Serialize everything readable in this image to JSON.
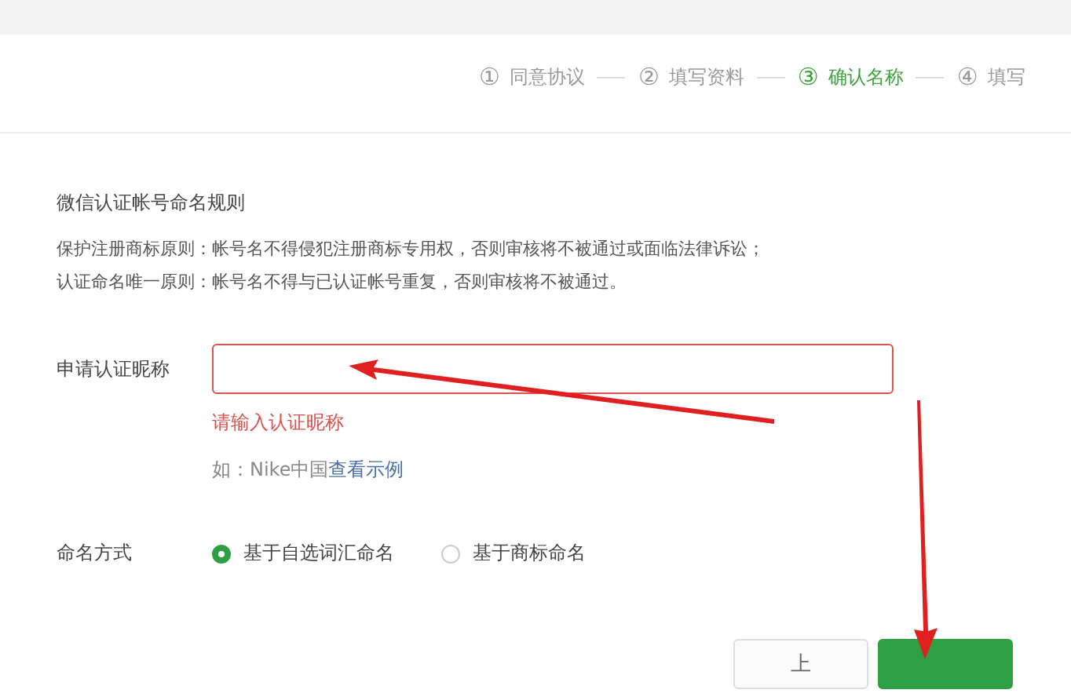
{
  "steps": [
    {
      "number": "①",
      "label": "同意协议",
      "selected": false
    },
    {
      "number": "②",
      "label": "填写资料",
      "selected": false
    },
    {
      "number": "③",
      "label": "确认名称",
      "selected": true
    },
    {
      "number": "④",
      "label": "填写",
      "selected": false
    }
  ],
  "rules": {
    "title": "微信认证帐号命名规则",
    "lines": [
      "保护注册商标原则：帐号名不得侵犯注册商标专用权，否则审核将不被通过或面临法律诉讼；",
      "认证命名唯一原则：帐号名不得与已认证帐号重复，否则审核将不被通过。"
    ]
  },
  "nickname": {
    "label": "申请认证昵称",
    "error": "请输入认证昵称",
    "hint": "如：Nike中国",
    "hint_link": "查看示例"
  },
  "naming": {
    "label": "命名方式",
    "options": [
      {
        "label": "基于自选词汇命名",
        "selected": true
      },
      {
        "label": "基于商标命名",
        "selected": false
      }
    ]
  },
  "buttons": [
    {
      "label": "上",
      "kind": "secondary"
    },
    {
      "kind": "primary"
    }
  ]
}
